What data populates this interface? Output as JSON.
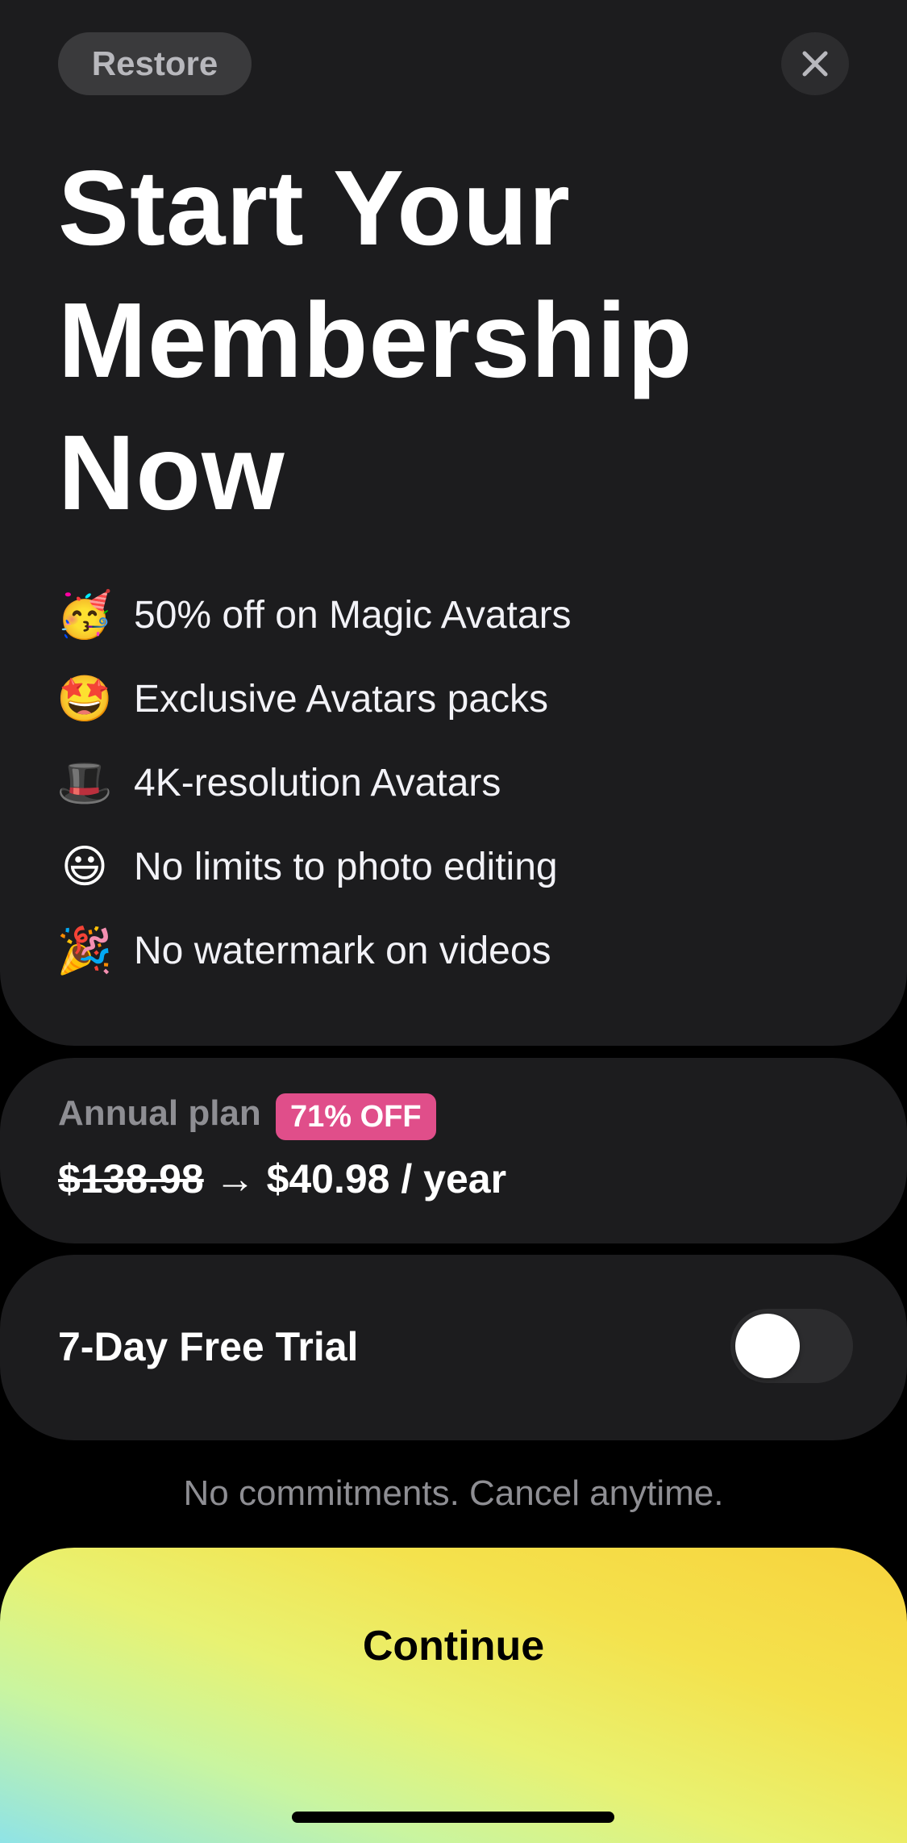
{
  "header": {
    "restore_label": "Restore",
    "close_icon": "close-icon"
  },
  "headline": {
    "line1": "Start Your",
    "line2": "Membership",
    "line3": "Now"
  },
  "features": [
    {
      "icon": "partying-face-emoji",
      "glyph": "🥳",
      "label": "50% off on Magic Avatars"
    },
    {
      "icon": "star-struck-emoji",
      "glyph": "🤩",
      "label": "Exclusive Avatars packs"
    },
    {
      "icon": "top-hat-emoji",
      "glyph": "🎩",
      "label": "4K-resolution Avatars"
    },
    {
      "icon": "grinning-face-emoji",
      "glyph": "😃",
      "label": "No limits to photo editing"
    },
    {
      "icon": "party-popper-emoji",
      "glyph": "🎉",
      "label": "No watermark on videos"
    }
  ],
  "plan": {
    "name": "Annual plan",
    "badge": "71% OFF",
    "old_price": "$138.98",
    "arrow": "→",
    "new_price": "$40.98 / year"
  },
  "trial": {
    "label": "7-Day Free Trial",
    "enabled": false
  },
  "disclaimer": "No commitments. Cancel anytime.",
  "cta": {
    "label": "Continue"
  },
  "colors": {
    "background": "#000000",
    "card": "#1c1c1e",
    "badge": "#e04e8a",
    "cta_gradient": [
      "#f7d33d",
      "#e8f272",
      "#8fe3e6"
    ]
  }
}
